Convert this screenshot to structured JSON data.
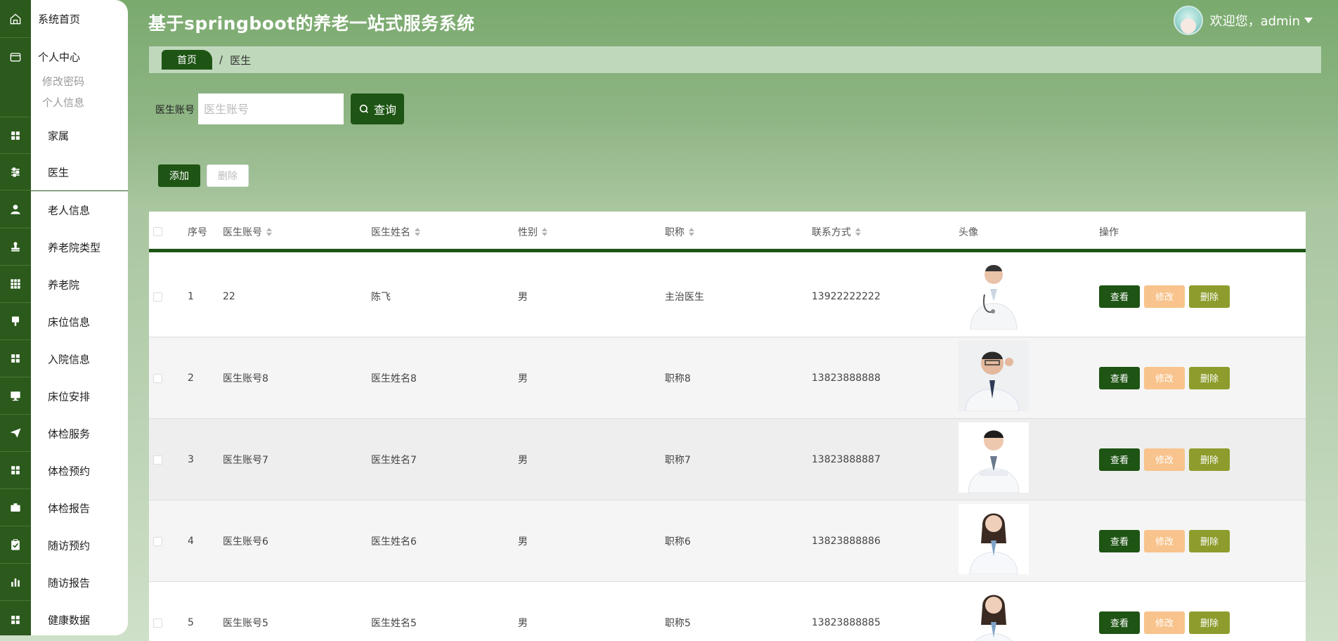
{
  "app": {
    "title": "基于springboot的养老一站式服务系统",
    "welcome": "欢迎您，admin"
  },
  "sidebar": {
    "home": "系统首页",
    "personal": "个人中心",
    "sub_items": [
      "修改密码",
      "个人信息"
    ],
    "items": [
      "家属",
      "医生",
      "老人信息",
      "养老院类型",
      "养老院",
      "床位信息",
      "入院信息",
      "床位安排",
      "体检服务",
      "体检预约",
      "体检报告",
      "随访预约",
      "随访报告",
      "健康数据"
    ],
    "active": "医生"
  },
  "breadcrumb": {
    "home": "首页",
    "separator": "/",
    "current": "医生"
  },
  "search": {
    "label": "医生账号",
    "placeholder": "医生账号",
    "value": "",
    "button": "查询"
  },
  "actions": {
    "add": "添加",
    "delete": "删除"
  },
  "table": {
    "columns": [
      "序号",
      "医生账号",
      "医生姓名",
      "性别",
      "职称",
      "联系方式",
      "头像",
      "操作"
    ],
    "rows": [
      {
        "index": "1",
        "account": "22",
        "name": "陈飞",
        "gender": "男",
        "title": "主治医生",
        "phone": "13922222222",
        "avatar": "male-doctor-stethoscope"
      },
      {
        "index": "2",
        "account": "医生账号8",
        "name": "医生姓名8",
        "gender": "男",
        "title": "职称8",
        "phone": "13823888888",
        "avatar": "male-doctor-glasses"
      },
      {
        "index": "3",
        "account": "医生账号7",
        "name": "医生姓名7",
        "gender": "男",
        "title": "职称7",
        "phone": "13823888887",
        "avatar": "male-doctor"
      },
      {
        "index": "4",
        "account": "医生账号6",
        "name": "医生姓名6",
        "gender": "男",
        "title": "职称6",
        "phone": "13823888886",
        "avatar": "female-doctor"
      },
      {
        "index": "5",
        "account": "医生账号5",
        "name": "医生姓名5",
        "gender": "男",
        "title": "职称5",
        "phone": "13823888885",
        "avatar": "female-doctor"
      }
    ],
    "row_actions": {
      "view": "查看",
      "edit": "修改",
      "delete": "删除"
    }
  },
  "colors": {
    "primary": "#1e5414",
    "edit": "#f8c38c",
    "delete": "#8d9c2c",
    "breadcrumb_bg": "#bfd8bb"
  }
}
